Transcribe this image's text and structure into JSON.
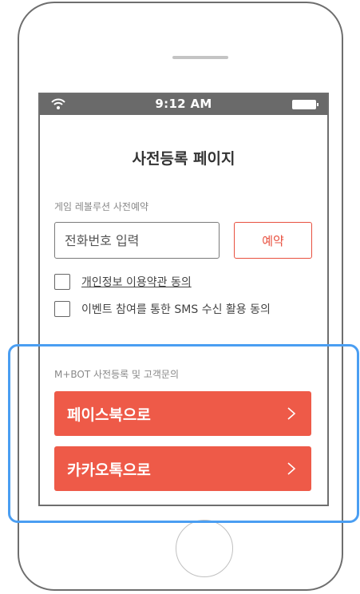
{
  "status_bar": {
    "time": "9:12 AM"
  },
  "page": {
    "title": "사전등록 페이지"
  },
  "preregistration": {
    "section_label": "게임 레볼루션 사전예약",
    "phone_placeholder": "전화번호 입력",
    "reserve_label": "예약",
    "agreements": [
      {
        "label": "개인정보 이용약관 동의",
        "checked": false
      },
      {
        "label": "이벤트 참여를 통한 SMS 수신 활용 동의",
        "checked": false
      }
    ]
  },
  "mbot": {
    "section_label": "M+BOT 사전등록 및 고객문의",
    "buttons": [
      {
        "label": "페이스북으로"
      },
      {
        "label": "카카오톡으로"
      }
    ]
  },
  "colors": {
    "accent_red": "#ee5a48",
    "highlight_blue": "#4a9ef2",
    "statusbar_gray": "#6a6a6a"
  }
}
